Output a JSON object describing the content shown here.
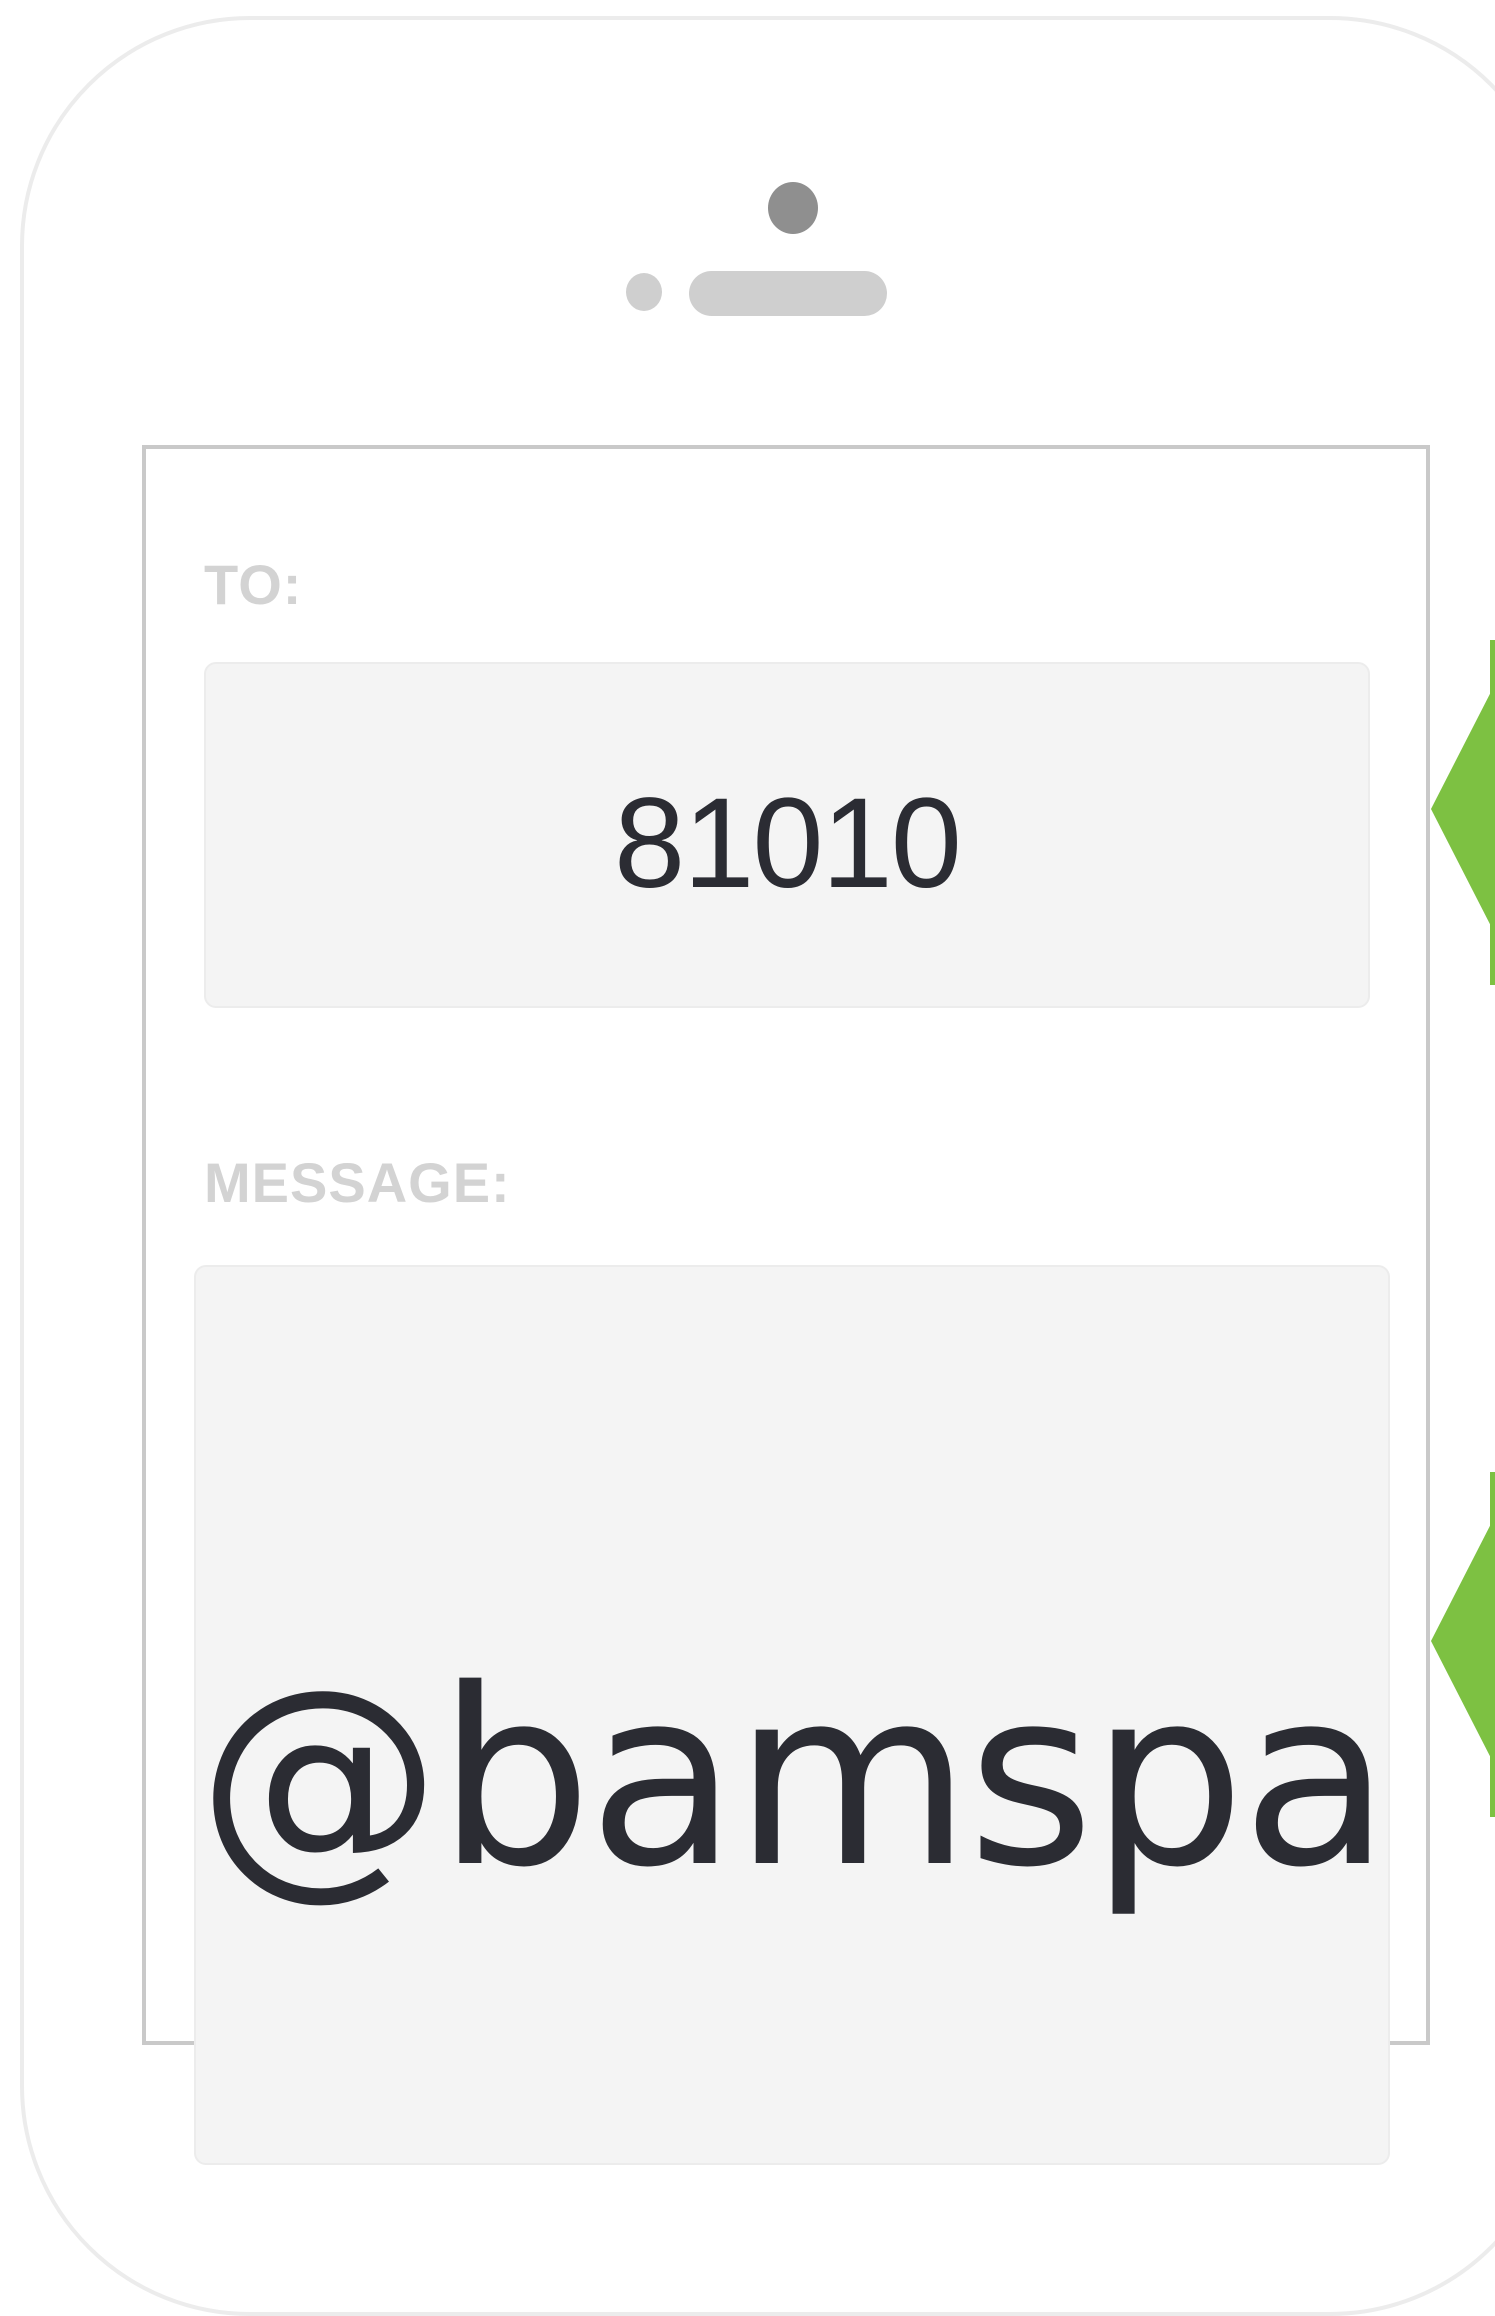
{
  "colors": {
    "label_gray": "#d3d3d3",
    "field_bg": "#f4f4f4",
    "text_dark": "#2b2c33",
    "accent_green": "#7dc142",
    "earpiece_gray": "#8f8f8f",
    "speaker_gray": "#cfcfcf"
  },
  "icons": {
    "camera": "front-camera-icon",
    "sensor": "proximity-sensor-icon",
    "speaker": "earpiece-speaker-icon",
    "pointer": "green-arrow-pointer-icon"
  },
  "compose": {
    "to_label": "TO:",
    "to_value": "81010",
    "message_label": "MESSAGE:",
    "message_value": "@bamspa"
  }
}
